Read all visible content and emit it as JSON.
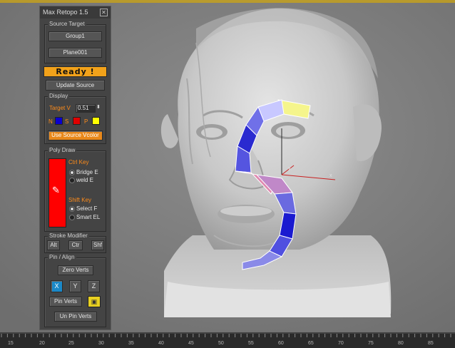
{
  "window_title": "Max Retopo 1.5",
  "source_target": {
    "label": "Source Target",
    "source_button": "Group1",
    "target_button": "Plane001"
  },
  "status": "Ready !",
  "update_button": "Update Source",
  "display": {
    "label": "Display",
    "target_v_label": "Target V",
    "target_v_value": "0.51",
    "n_label": "N",
    "s_label": "S",
    "p_label": "P",
    "swatches": {
      "n": "#0a00d0",
      "s": "#e00000",
      "p": "#ffff00"
    },
    "use_source_vcolor": "Use Source Vcolor"
  },
  "poly_draw": {
    "label": "Poly Draw",
    "ctrl_key_label": "Ctrl Key",
    "ctrl_options": [
      "Bridge E",
      "weld E"
    ],
    "shift_key_label": "Shift Key",
    "shift_options": [
      "Select F",
      "Smart EL"
    ]
  },
  "stroke_modifier": {
    "label": "Stroke Modifier",
    "buttons": [
      "Alt",
      "Ctr",
      "Shf"
    ]
  },
  "pin_align": {
    "label": "Pin / Align",
    "zero_verts": "Zero Verts",
    "axes": [
      "X",
      "Y",
      "Z"
    ],
    "pin_verts": "Pin Verts",
    "unpin_verts": "Un Pin Verts"
  },
  "gizmo": {
    "y_label": "y",
    "x_label": "x"
  },
  "ruler_ticks": [
    "15",
    "20",
    "25",
    "30",
    "35",
    "40",
    "45",
    "50",
    "55",
    "60",
    "65",
    "70",
    "75",
    "80",
    "85"
  ],
  "colors": {
    "accent_orange": "#f2a21a",
    "selected_axis": "#1a88c8"
  }
}
